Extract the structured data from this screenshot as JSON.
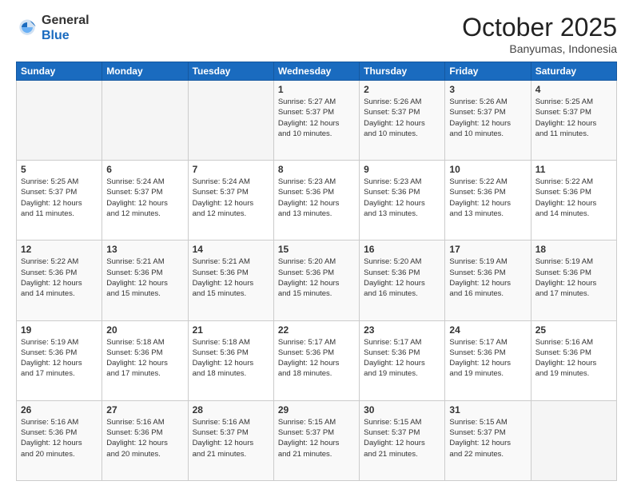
{
  "logo": {
    "general": "General",
    "blue": "Blue"
  },
  "title": "October 2025",
  "location": "Banyumas, Indonesia",
  "days_header": [
    "Sunday",
    "Monday",
    "Tuesday",
    "Wednesday",
    "Thursday",
    "Friday",
    "Saturday"
  ],
  "weeks": [
    [
      {
        "day": "",
        "info": ""
      },
      {
        "day": "",
        "info": ""
      },
      {
        "day": "",
        "info": ""
      },
      {
        "day": "1",
        "info": "Sunrise: 5:27 AM\nSunset: 5:37 PM\nDaylight: 12 hours\nand 10 minutes."
      },
      {
        "day": "2",
        "info": "Sunrise: 5:26 AM\nSunset: 5:37 PM\nDaylight: 12 hours\nand 10 minutes."
      },
      {
        "day": "3",
        "info": "Sunrise: 5:26 AM\nSunset: 5:37 PM\nDaylight: 12 hours\nand 10 minutes."
      },
      {
        "day": "4",
        "info": "Sunrise: 5:25 AM\nSunset: 5:37 PM\nDaylight: 12 hours\nand 11 minutes."
      }
    ],
    [
      {
        "day": "5",
        "info": "Sunrise: 5:25 AM\nSunset: 5:37 PM\nDaylight: 12 hours\nand 11 minutes."
      },
      {
        "day": "6",
        "info": "Sunrise: 5:24 AM\nSunset: 5:37 PM\nDaylight: 12 hours\nand 12 minutes."
      },
      {
        "day": "7",
        "info": "Sunrise: 5:24 AM\nSunset: 5:37 PM\nDaylight: 12 hours\nand 12 minutes."
      },
      {
        "day": "8",
        "info": "Sunrise: 5:23 AM\nSunset: 5:36 PM\nDaylight: 12 hours\nand 13 minutes."
      },
      {
        "day": "9",
        "info": "Sunrise: 5:23 AM\nSunset: 5:36 PM\nDaylight: 12 hours\nand 13 minutes."
      },
      {
        "day": "10",
        "info": "Sunrise: 5:22 AM\nSunset: 5:36 PM\nDaylight: 12 hours\nand 13 minutes."
      },
      {
        "day": "11",
        "info": "Sunrise: 5:22 AM\nSunset: 5:36 PM\nDaylight: 12 hours\nand 14 minutes."
      }
    ],
    [
      {
        "day": "12",
        "info": "Sunrise: 5:22 AM\nSunset: 5:36 PM\nDaylight: 12 hours\nand 14 minutes."
      },
      {
        "day": "13",
        "info": "Sunrise: 5:21 AM\nSunset: 5:36 PM\nDaylight: 12 hours\nand 15 minutes."
      },
      {
        "day": "14",
        "info": "Sunrise: 5:21 AM\nSunset: 5:36 PM\nDaylight: 12 hours\nand 15 minutes."
      },
      {
        "day": "15",
        "info": "Sunrise: 5:20 AM\nSunset: 5:36 PM\nDaylight: 12 hours\nand 15 minutes."
      },
      {
        "day": "16",
        "info": "Sunrise: 5:20 AM\nSunset: 5:36 PM\nDaylight: 12 hours\nand 16 minutes."
      },
      {
        "day": "17",
        "info": "Sunrise: 5:19 AM\nSunset: 5:36 PM\nDaylight: 12 hours\nand 16 minutes."
      },
      {
        "day": "18",
        "info": "Sunrise: 5:19 AM\nSunset: 5:36 PM\nDaylight: 12 hours\nand 17 minutes."
      }
    ],
    [
      {
        "day": "19",
        "info": "Sunrise: 5:19 AM\nSunset: 5:36 PM\nDaylight: 12 hours\nand 17 minutes."
      },
      {
        "day": "20",
        "info": "Sunrise: 5:18 AM\nSunset: 5:36 PM\nDaylight: 12 hours\nand 17 minutes."
      },
      {
        "day": "21",
        "info": "Sunrise: 5:18 AM\nSunset: 5:36 PM\nDaylight: 12 hours\nand 18 minutes."
      },
      {
        "day": "22",
        "info": "Sunrise: 5:17 AM\nSunset: 5:36 PM\nDaylight: 12 hours\nand 18 minutes."
      },
      {
        "day": "23",
        "info": "Sunrise: 5:17 AM\nSunset: 5:36 PM\nDaylight: 12 hours\nand 19 minutes."
      },
      {
        "day": "24",
        "info": "Sunrise: 5:17 AM\nSunset: 5:36 PM\nDaylight: 12 hours\nand 19 minutes."
      },
      {
        "day": "25",
        "info": "Sunrise: 5:16 AM\nSunset: 5:36 PM\nDaylight: 12 hours\nand 19 minutes."
      }
    ],
    [
      {
        "day": "26",
        "info": "Sunrise: 5:16 AM\nSunset: 5:36 PM\nDaylight: 12 hours\nand 20 minutes."
      },
      {
        "day": "27",
        "info": "Sunrise: 5:16 AM\nSunset: 5:36 PM\nDaylight: 12 hours\nand 20 minutes."
      },
      {
        "day": "28",
        "info": "Sunrise: 5:16 AM\nSunset: 5:37 PM\nDaylight: 12 hours\nand 21 minutes."
      },
      {
        "day": "29",
        "info": "Sunrise: 5:15 AM\nSunset: 5:37 PM\nDaylight: 12 hours\nand 21 minutes."
      },
      {
        "day": "30",
        "info": "Sunrise: 5:15 AM\nSunset: 5:37 PM\nDaylight: 12 hours\nand 21 minutes."
      },
      {
        "day": "31",
        "info": "Sunrise: 5:15 AM\nSunset: 5:37 PM\nDaylight: 12 hours\nand 22 minutes."
      },
      {
        "day": "",
        "info": ""
      }
    ]
  ]
}
